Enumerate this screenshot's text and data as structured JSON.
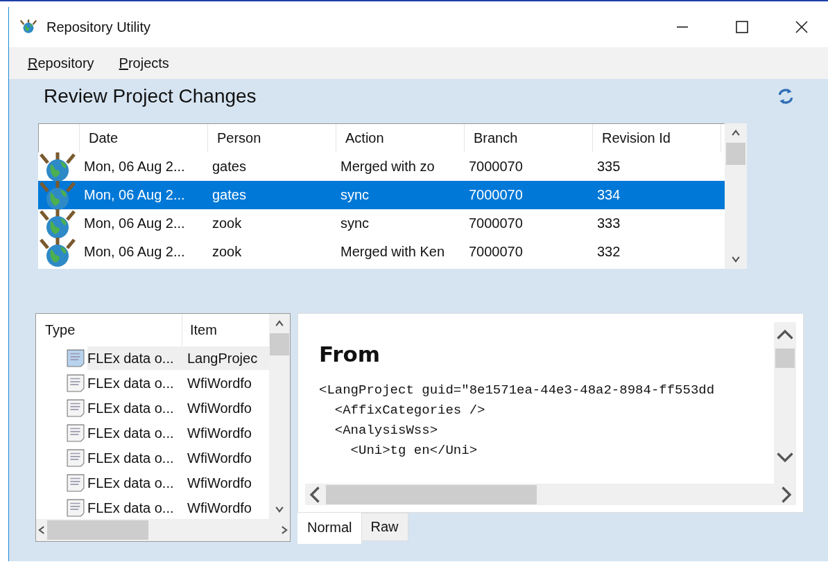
{
  "window": {
    "title": "Repository Utility"
  },
  "menu": [
    "Repository",
    "Projects"
  ],
  "heading": "Review Project Changes",
  "revisions": {
    "columns": [
      "Date",
      "Person",
      "Action",
      "Branch",
      "Revision Id"
    ],
    "rows": [
      {
        "cells": [
          "Mon, 06 Aug 2...",
          "gates",
          "Merged with zo",
          "7000070",
          "335"
        ],
        "selected": false
      },
      {
        "cells": [
          "Mon, 06 Aug 2...",
          "gates",
          "sync",
          "7000070",
          "334"
        ],
        "selected": true
      },
      {
        "cells": [
          "Mon, 06 Aug 2...",
          "zook",
          "sync",
          "7000070",
          "333"
        ],
        "selected": false
      },
      {
        "cells": [
          "Mon, 06 Aug 2...",
          "zook",
          "Merged with Ken",
          "7000070",
          "332"
        ],
        "selected": false
      }
    ]
  },
  "changes": {
    "columns": [
      "Type",
      "Item"
    ],
    "rows": [
      {
        "cells": [
          "FLEx data o...",
          "LangProjec"
        ],
        "selected": true
      },
      {
        "cells": [
          "FLEx data o...",
          "WfiWordfo"
        ],
        "selected": false
      },
      {
        "cells": [
          "FLEx data o...",
          "WfiWordfo"
        ],
        "selected": false
      },
      {
        "cells": [
          "FLEx data o...",
          "WfiWordfo"
        ],
        "selected": false
      },
      {
        "cells": [
          "FLEx data o...",
          "WfiWordfo"
        ],
        "selected": false
      },
      {
        "cells": [
          "FLEx data o...",
          "WfiWordfo"
        ],
        "selected": false
      },
      {
        "cells": [
          "FLEx data o...",
          "WfiWordfo"
        ],
        "selected": false
      }
    ]
  },
  "detail": {
    "heading": "From",
    "lines": [
      "<LangProject guid=\"8e1571ea-44e3-48a2-8984-ff553dd",
      "  <AffixCategories />",
      "  <AnalysisWss>",
      "    <Uni>tg en</Uni>"
    ],
    "tabs": [
      {
        "label": "Normal",
        "selected": true
      },
      {
        "label": "Raw",
        "selected": false
      }
    ]
  }
}
